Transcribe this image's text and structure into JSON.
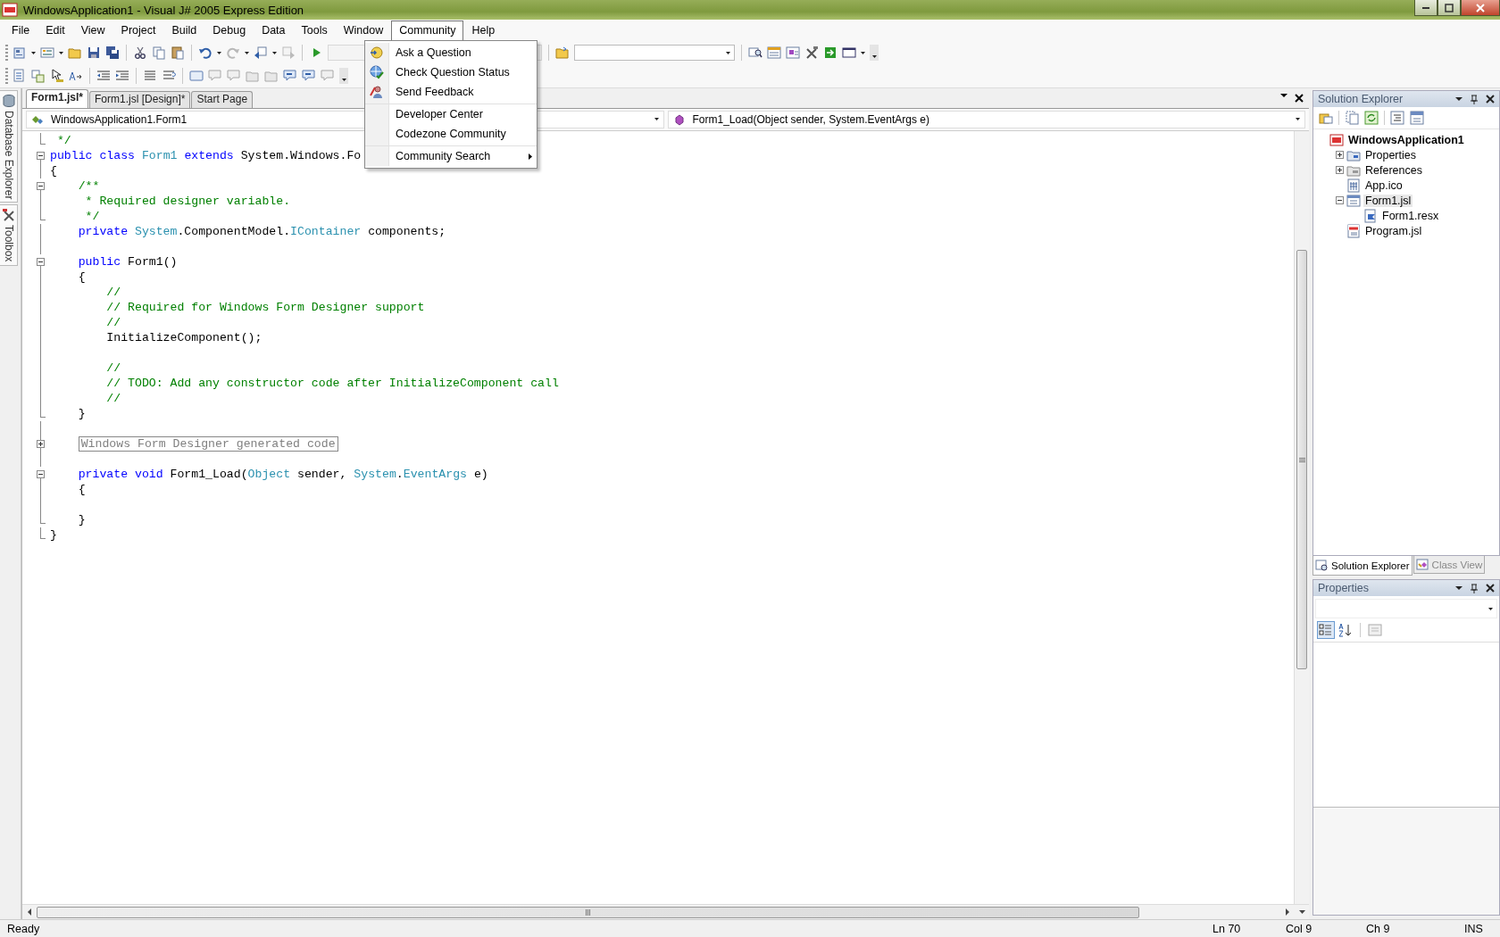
{
  "window": {
    "title": "WindowsApplication1 - Visual J# 2005 Express Edition"
  },
  "menu_bar": [
    {
      "label": "File",
      "selected": false
    },
    {
      "label": "Edit",
      "selected": false
    },
    {
      "label": "View",
      "selected": false
    },
    {
      "label": "Project",
      "selected": false
    },
    {
      "label": "Build",
      "selected": false
    },
    {
      "label": "Debug",
      "selected": false
    },
    {
      "label": "Data",
      "selected": false
    },
    {
      "label": "Tools",
      "selected": false
    },
    {
      "label": "Window",
      "selected": false
    },
    {
      "label": "Community",
      "selected": true
    },
    {
      "label": "Help",
      "selected": false
    }
  ],
  "community_menu": [
    {
      "label": "Ask a Question",
      "kind": "ask",
      "separator_before": false,
      "has_submenu": false
    },
    {
      "label": "Check Question Status",
      "kind": "status",
      "separator_before": false,
      "has_submenu": false
    },
    {
      "label": "Send Feedback",
      "kind": "feedback",
      "separator_before": false,
      "has_submenu": false
    },
    {
      "label": "Developer Center",
      "kind": "text",
      "separator_before": true,
      "has_submenu": false
    },
    {
      "label": "Codezone Community",
      "kind": "text",
      "separator_before": false,
      "has_submenu": false
    },
    {
      "label": "Community Search",
      "kind": "text",
      "separator_before": true,
      "has_submenu": true
    }
  ],
  "left_rail": [
    {
      "label": "Database Explorer"
    },
    {
      "label": "Toolbox"
    }
  ],
  "document_tabs": [
    {
      "label": "Form1.jsl*",
      "selected": true
    },
    {
      "label": "Form1.jsl [Design]*",
      "selected": false
    },
    {
      "label": "Start Page",
      "selected": false
    }
  ],
  "navigation": {
    "type_dropdown": "WindowsApplication1.Form1",
    "member_dropdown": "Form1_Load(Object sender, System.EventArgs e)"
  },
  "code_lines": [
    {
      "kind": "end",
      "tokens": [
        {
          "kind": "comment",
          "text": " */"
        }
      ]
    },
    {
      "kind": "start",
      "tokens": [
        {
          "kind": "keyword",
          "text": "public class "
        },
        {
          "kind": "type",
          "text": "Form1"
        },
        {
          "kind": "keyword",
          "text": " extends "
        },
        {
          "kind": "plain",
          "text": "System.Windows.Fo"
        }
      ]
    },
    {
      "kind": "body",
      "tokens": [
        {
          "kind": "plain",
          "text": "{"
        }
      ]
    },
    {
      "kind": "start",
      "tokens": [
        {
          "kind": "comment",
          "text": "    /**"
        }
      ]
    },
    {
      "kind": "body",
      "tokens": [
        {
          "kind": "comment",
          "text": "     * Required designer variable."
        }
      ]
    },
    {
      "kind": "end",
      "tokens": [
        {
          "kind": "comment",
          "text": "     */"
        }
      ]
    },
    {
      "kind": "body",
      "tokens": [
        {
          "kind": "keyword",
          "text": "    private "
        },
        {
          "kind": "type",
          "text": "System"
        },
        {
          "kind": "plain",
          "text": ".ComponentModel."
        },
        {
          "kind": "type",
          "text": "IContainer"
        },
        {
          "kind": "plain",
          "text": " components;"
        }
      ]
    },
    {
      "kind": "body"
    },
    {
      "kind": "start",
      "tokens": [
        {
          "kind": "keyword",
          "text": "    public "
        },
        {
          "kind": "plain",
          "text": "Form1()"
        }
      ]
    },
    {
      "kind": "body",
      "tokens": [
        {
          "kind": "plain",
          "text": "    {"
        }
      ]
    },
    {
      "kind": "body",
      "tokens": [
        {
          "kind": "comment",
          "text": "        //"
        }
      ]
    },
    {
      "kind": "body",
      "tokens": [
        {
          "kind": "comment",
          "text": "        // Required for Windows Form Designer support"
        }
      ]
    },
    {
      "kind": "body",
      "tokens": [
        {
          "kind": "comment",
          "text": "        //"
        }
      ]
    },
    {
      "kind": "body",
      "tokens": [
        {
          "kind": "plain",
          "text": "        InitializeComponent();"
        }
      ]
    },
    {
      "kind": "body"
    },
    {
      "kind": "body",
      "tokens": [
        {
          "kind": "comment",
          "text": "        //"
        }
      ]
    },
    {
      "kind": "body",
      "tokens": [
        {
          "kind": "comment",
          "text": "        // TODO: Add any constructor code after InitializeComponent call"
        }
      ]
    },
    {
      "kind": "body",
      "tokens": [
        {
          "kind": "comment",
          "text": "        //"
        }
      ]
    },
    {
      "kind": "end",
      "tokens": [
        {
          "kind": "plain",
          "text": "    }"
        }
      ]
    },
    {
      "kind": "body"
    },
    {
      "kind": "collapsed",
      "tokens": [
        {
          "kind": "region",
          "text": "Windows Form Designer generated code"
        }
      ]
    },
    {
      "kind": "body"
    },
    {
      "kind": "start",
      "tokens": [
        {
          "kind": "keyword",
          "text": "    private void "
        },
        {
          "kind": "plain",
          "text": "Form1_Load("
        },
        {
          "kind": "type",
          "text": "Object"
        },
        {
          "kind": "plain",
          "text": " sender, "
        },
        {
          "kind": "type",
          "text": "System"
        },
        {
          "kind": "plain",
          "text": "."
        },
        {
          "kind": "type",
          "text": "EventArgs"
        },
        {
          "kind": "plain",
          "text": " e)"
        }
      ]
    },
    {
      "kind": "body",
      "tokens": [
        {
          "kind": "plain",
          "text": "    {"
        }
      ]
    },
    {
      "kind": "body"
    },
    {
      "kind": "end",
      "tokens": [
        {
          "kind": "plain",
          "text": "    }"
        }
      ]
    },
    {
      "kind": "end",
      "tokens": [
        {
          "kind": "plain",
          "text": "}"
        }
      ]
    }
  ],
  "solution_explorer": {
    "title": "Solution Explorer",
    "items": [
      {
        "label": "WindowsApplication1",
        "kind": "project",
        "selected": false,
        "children": [
          {
            "label": "Properties",
            "kind": "properties",
            "selected": false,
            "expanded": false
          },
          {
            "label": "References",
            "kind": "references",
            "selected": false,
            "expanded": false
          },
          {
            "label": "App.ico",
            "kind": "icon-file",
            "selected": false
          },
          {
            "label": "Form1.jsl",
            "kind": "form",
            "selected": true,
            "expanded": true,
            "children": [
              {
                "label": "Form1.resx",
                "kind": "resx",
                "selected": false
              }
            ]
          },
          {
            "label": "Program.jsl",
            "kind": "source",
            "selected": false
          }
        ]
      }
    ]
  },
  "panel_tabs": [
    {
      "label": "Solution Explorer",
      "selected": true
    },
    {
      "label": "Class View",
      "selected": false
    }
  ],
  "properties": {
    "title": "Properties"
  },
  "status_bar": {
    "message": "Ready",
    "line": "Ln 70",
    "column": "Col 9",
    "character": "Ch 9",
    "mode": "INS"
  }
}
